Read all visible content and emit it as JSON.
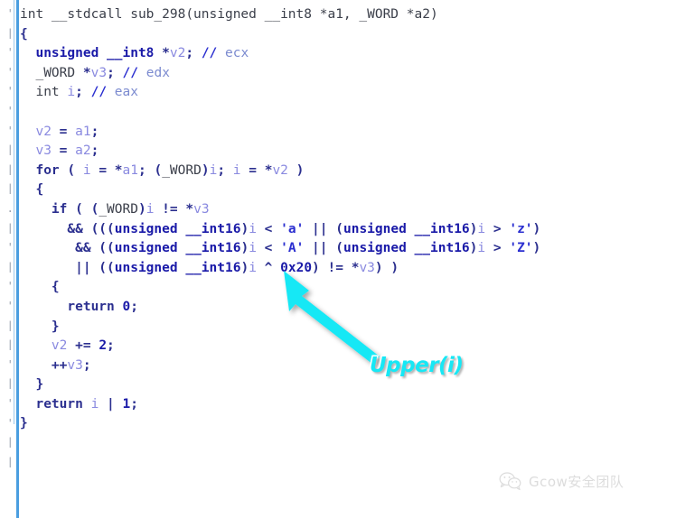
{
  "view": {
    "kind": "ida-pseudocode",
    "background_color": "#ffffff",
    "gutter_rule_color": "#4a9ee0"
  },
  "gutter": {
    "marks": [
      "'",
      "|",
      "'",
      "'",
      "'",
      "'",
      "'",
      "|",
      "|",
      "|",
      ".",
      "|",
      "'",
      "|",
      "'",
      "'",
      "|",
      "|",
      "'",
      "|",
      "'",
      "'",
      "|",
      "|"
    ]
  },
  "code": {
    "language": "c",
    "function_name": "sub_298",
    "lines": [
      [
        {
          "t": "int __stdcall sub_298(unsigned __int8 *a1, _WORD *a2)",
          "c": "t-plain"
        }
      ],
      [
        {
          "t": "{",
          "c": "t-punct"
        }
      ],
      [
        {
          "t": "  ",
          "c": "t-plain"
        },
        {
          "t": "unsigned __int8",
          "c": "t-kw"
        },
        {
          "t": " *",
          "c": "t-punct"
        },
        {
          "t": "v2",
          "c": "t-var"
        },
        {
          "t": "; ",
          "c": "t-punct"
        },
        {
          "t": "//",
          "c": "t-cmtmark"
        },
        {
          "t": " ecx",
          "c": "t-cmt"
        }
      ],
      [
        {
          "t": "  ",
          "c": "t-plain"
        },
        {
          "t": "_WORD",
          "c": "t-plain"
        },
        {
          "t": " *",
          "c": "t-punct"
        },
        {
          "t": "v3",
          "c": "t-var"
        },
        {
          "t": "; ",
          "c": "t-punct"
        },
        {
          "t": "//",
          "c": "t-cmtmark"
        },
        {
          "t": " edx",
          "c": "t-cmt"
        }
      ],
      [
        {
          "t": "  ",
          "c": "t-plain"
        },
        {
          "t": "int",
          "c": "t-plain"
        },
        {
          "t": " ",
          "c": "t-plain"
        },
        {
          "t": "i",
          "c": "t-var"
        },
        {
          "t": "; ",
          "c": "t-punct"
        },
        {
          "t": "//",
          "c": "t-cmtmark"
        },
        {
          "t": " eax",
          "c": "t-cmt"
        }
      ],
      [
        {
          "t": "",
          "c": "t-plain"
        }
      ],
      [
        {
          "t": "  ",
          "c": "t-plain"
        },
        {
          "t": "v2",
          "c": "t-var"
        },
        {
          "t": " = ",
          "c": "t-punct"
        },
        {
          "t": "a1",
          "c": "t-var"
        },
        {
          "t": ";",
          "c": "t-punct"
        }
      ],
      [
        {
          "t": "  ",
          "c": "t-plain"
        },
        {
          "t": "v3",
          "c": "t-var"
        },
        {
          "t": " = ",
          "c": "t-punct"
        },
        {
          "t": "a2",
          "c": "t-var"
        },
        {
          "t": ";",
          "c": "t-punct"
        }
      ],
      [
        {
          "t": "  ",
          "c": "t-plain"
        },
        {
          "t": "for",
          "c": "t-punct"
        },
        {
          "t": " ( ",
          "c": "t-punct"
        },
        {
          "t": "i",
          "c": "t-var"
        },
        {
          "t": " = *",
          "c": "t-punct"
        },
        {
          "t": "a1",
          "c": "t-var"
        },
        {
          "t": "; (",
          "c": "t-punct"
        },
        {
          "t": "_WORD",
          "c": "t-plain"
        },
        {
          "t": ")",
          "c": "t-punct"
        },
        {
          "t": "i",
          "c": "t-var"
        },
        {
          "t": "; ",
          "c": "t-punct"
        },
        {
          "t": "i",
          "c": "t-var"
        },
        {
          "t": " = *",
          "c": "t-punct"
        },
        {
          "t": "v2",
          "c": "t-var"
        },
        {
          "t": " )",
          "c": "t-punct"
        }
      ],
      [
        {
          "t": "  {",
          "c": "t-punct"
        }
      ],
      [
        {
          "t": "    ",
          "c": "t-plain"
        },
        {
          "t": "if",
          "c": "t-punct"
        },
        {
          "t": " ( (",
          "c": "t-punct"
        },
        {
          "t": "_WORD",
          "c": "t-plain"
        },
        {
          "t": ")",
          "c": "t-punct"
        },
        {
          "t": "i",
          "c": "t-var"
        },
        {
          "t": " != *",
          "c": "t-punct"
        },
        {
          "t": "v3",
          "c": "t-var"
        }
      ],
      [
        {
          "t": "      && (((",
          "c": "t-punct"
        },
        {
          "t": "unsigned __int16",
          "c": "t-kw"
        },
        {
          "t": ")",
          "c": "t-punct"
        },
        {
          "t": "i",
          "c": "t-var"
        },
        {
          "t": " < ",
          "c": "t-punct"
        },
        {
          "t": "'a'",
          "c": "t-str"
        },
        {
          "t": " || (",
          "c": "t-punct"
        },
        {
          "t": "unsigned __int16",
          "c": "t-kw"
        },
        {
          "t": ")",
          "c": "t-punct"
        },
        {
          "t": "i",
          "c": "t-var"
        },
        {
          "t": " > ",
          "c": "t-punct"
        },
        {
          "t": "'z'",
          "c": "t-str"
        },
        {
          "t": ")",
          "c": "t-punct"
        }
      ],
      [
        {
          "t": "       && ((",
          "c": "t-punct"
        },
        {
          "t": "unsigned __int16",
          "c": "t-kw"
        },
        {
          "t": ")",
          "c": "t-punct"
        },
        {
          "t": "i",
          "c": "t-var"
        },
        {
          "t": " < ",
          "c": "t-punct"
        },
        {
          "t": "'A'",
          "c": "t-str"
        },
        {
          "t": " || (",
          "c": "t-punct"
        },
        {
          "t": "unsigned __int16",
          "c": "t-kw"
        },
        {
          "t": ")",
          "c": "t-punct"
        },
        {
          "t": "i",
          "c": "t-var"
        },
        {
          "t": " > ",
          "c": "t-punct"
        },
        {
          "t": "'Z'",
          "c": "t-str"
        },
        {
          "t": ")",
          "c": "t-punct"
        }
      ],
      [
        {
          "t": "       || ((",
          "c": "t-punct"
        },
        {
          "t": "unsigned __int16",
          "c": "t-kw"
        },
        {
          "t": ")",
          "c": "t-punct"
        },
        {
          "t": "i",
          "c": "t-var"
        },
        {
          "t": " ^ ",
          "c": "t-punct"
        },
        {
          "t": "0x20",
          "c": "t-num"
        },
        {
          "t": ") != *",
          "c": "t-punct"
        },
        {
          "t": "v3",
          "c": "t-var"
        },
        {
          "t": ") )",
          "c": "t-punct"
        }
      ],
      [
        {
          "t": "    {",
          "c": "t-punct"
        }
      ],
      [
        {
          "t": "      ",
          "c": "t-plain"
        },
        {
          "t": "return",
          "c": "t-punct"
        },
        {
          "t": " ",
          "c": "t-plain"
        },
        {
          "t": "0",
          "c": "t-num"
        },
        {
          "t": ";",
          "c": "t-punct"
        }
      ],
      [
        {
          "t": "    }",
          "c": "t-punct"
        }
      ],
      [
        {
          "t": "    ",
          "c": "t-plain"
        },
        {
          "t": "v2",
          "c": "t-var"
        },
        {
          "t": " += ",
          "c": "t-punct"
        },
        {
          "t": "2",
          "c": "t-num"
        },
        {
          "t": ";",
          "c": "t-punct"
        }
      ],
      [
        {
          "t": "    ++",
          "c": "t-punct"
        },
        {
          "t": "v3",
          "c": "t-var"
        },
        {
          "t": ";",
          "c": "t-punct"
        }
      ],
      [
        {
          "t": "  }",
          "c": "t-punct"
        }
      ],
      [
        {
          "t": "  ",
          "c": "t-plain"
        },
        {
          "t": "return",
          "c": "t-punct"
        },
        {
          "t": " ",
          "c": "t-plain"
        },
        {
          "t": "i",
          "c": "t-var"
        },
        {
          "t": " | ",
          "c": "t-punct"
        },
        {
          "t": "1",
          "c": "t-num"
        },
        {
          "t": ";",
          "c": "t-punct"
        }
      ],
      [
        {
          "t": "}",
          "c": "t-punct"
        }
      ]
    ]
  },
  "annotation": {
    "label": "Upper(i)",
    "color": "#16e8f5",
    "outline_color": "#ffffff",
    "arrow_color": "#16e8f5",
    "points_to": "((unsigned __int16)i ^ 0x20) != *v3"
  },
  "watermark": {
    "text": "Gcow安全团队",
    "icon": "wechat-icon",
    "color": "#8d8d8d"
  }
}
